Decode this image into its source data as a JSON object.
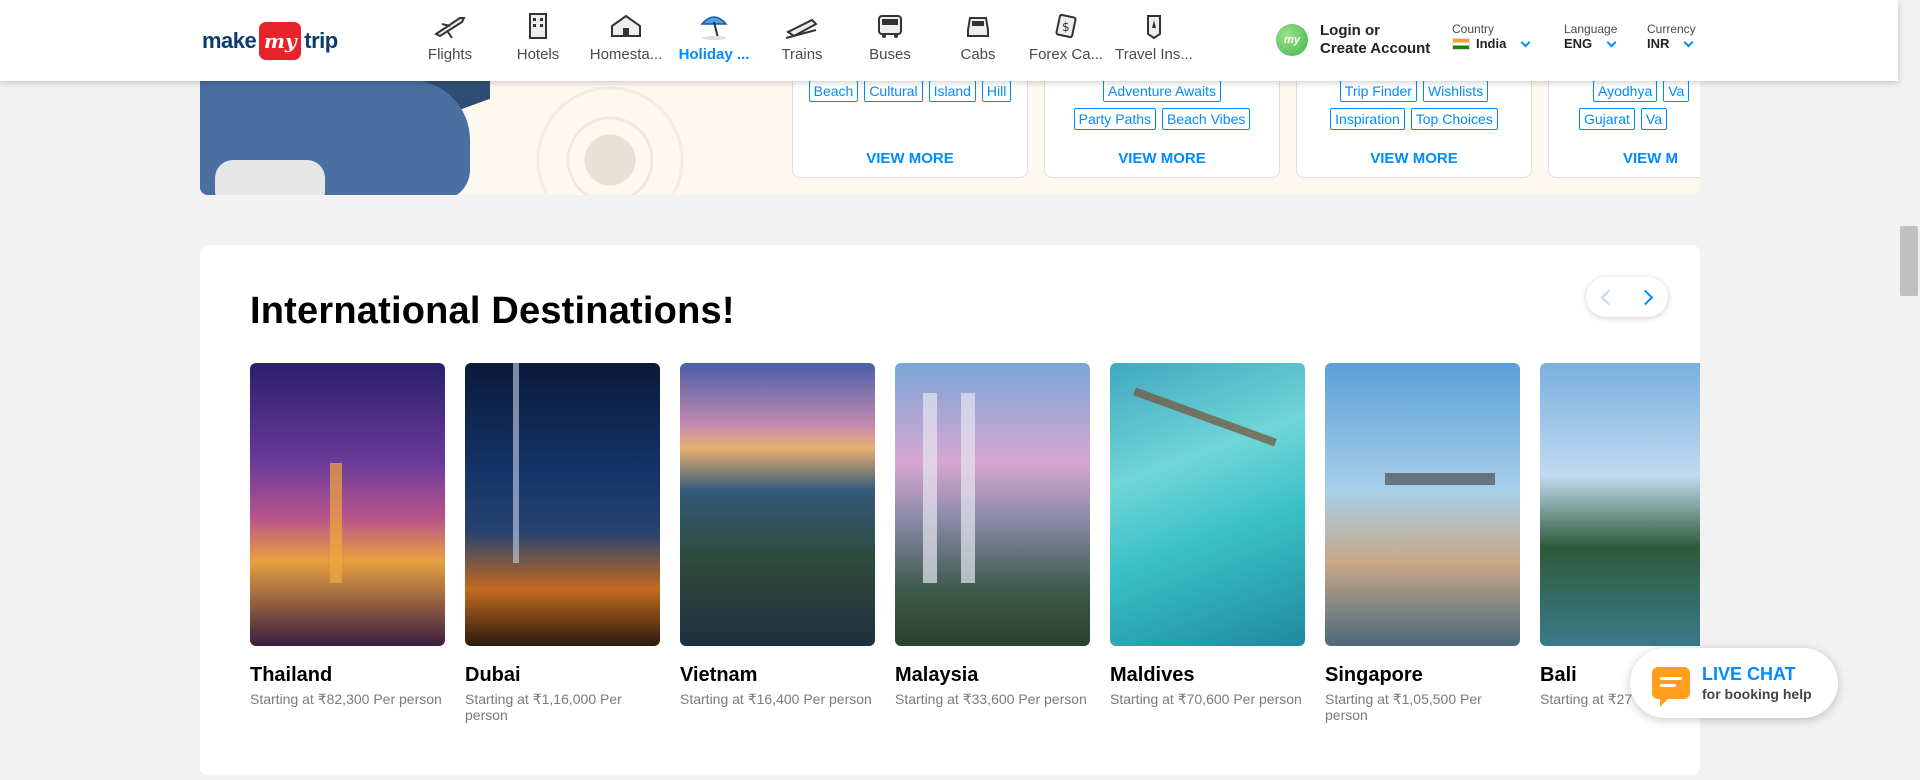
{
  "logo": {
    "part1": "make",
    "part2": "my",
    "part3": "trip"
  },
  "nav": [
    {
      "label": "Flights",
      "icon": "plane-icon"
    },
    {
      "label": "Hotels",
      "icon": "hotel-icon"
    },
    {
      "label": "Homesta...",
      "icon": "homestay-icon"
    },
    {
      "label": "Holiday ...",
      "icon": "umbrella-icon",
      "active": true
    },
    {
      "label": "Trains",
      "icon": "train-icon"
    },
    {
      "label": "Buses",
      "icon": "bus-icon"
    },
    {
      "label": "Cabs",
      "icon": "cab-icon"
    },
    {
      "label": "Forex Ca...",
      "icon": "forex-icon"
    },
    {
      "label": "Travel Ins...",
      "icon": "insurance-icon"
    }
  ],
  "account": {
    "badge": "my",
    "line1": "Login or",
    "line2": "Create Account"
  },
  "prefs": {
    "country": {
      "label": "Country",
      "value": "India"
    },
    "language": {
      "label": "Language",
      "value": "ENG"
    },
    "currency": {
      "label": "Currency",
      "value": "INR"
    }
  },
  "theme_cards": [
    {
      "tags": [
        "Beach",
        "Cultural",
        "Island",
        "Hill"
      ],
      "view_more": "VIEW MORE"
    },
    {
      "tags": [
        "Adventure Awaits",
        "Party Paths",
        "Beach Vibes"
      ],
      "view_more": "VIEW MORE"
    },
    {
      "tags": [
        "Trip Finder",
        "Wishlists",
        "Inspiration",
        "Top Choices"
      ],
      "view_more": "VIEW MORE"
    },
    {
      "tags": [
        "Ayodhya",
        "Va",
        "Gujarat",
        "Va"
      ],
      "view_more": "VIEW M"
    }
  ],
  "destinations": {
    "title": "International Destinations!",
    "items": [
      {
        "name": "Thailand",
        "price": "Starting at ₹82,300 Per person"
      },
      {
        "name": "Dubai",
        "price": "Starting at ₹1,16,000 Per person"
      },
      {
        "name": "Vietnam",
        "price": "Starting at ₹16,400 Per person"
      },
      {
        "name": "Malaysia",
        "price": "Starting at ₹33,600 Per person"
      },
      {
        "name": "Maldives",
        "price": "Starting at ₹70,600 Per person"
      },
      {
        "name": "Singapore",
        "price": "Starting at ₹1,05,500 Per person"
      },
      {
        "name": "Bali",
        "price": "Starting at ₹27"
      }
    ]
  },
  "livechat": {
    "title": "LIVE CHAT",
    "subtitle": "for booking help"
  },
  "colors": {
    "accent": "#008cff",
    "brand_red": "#e8232a",
    "chat_orange": "#ff9f1c"
  }
}
